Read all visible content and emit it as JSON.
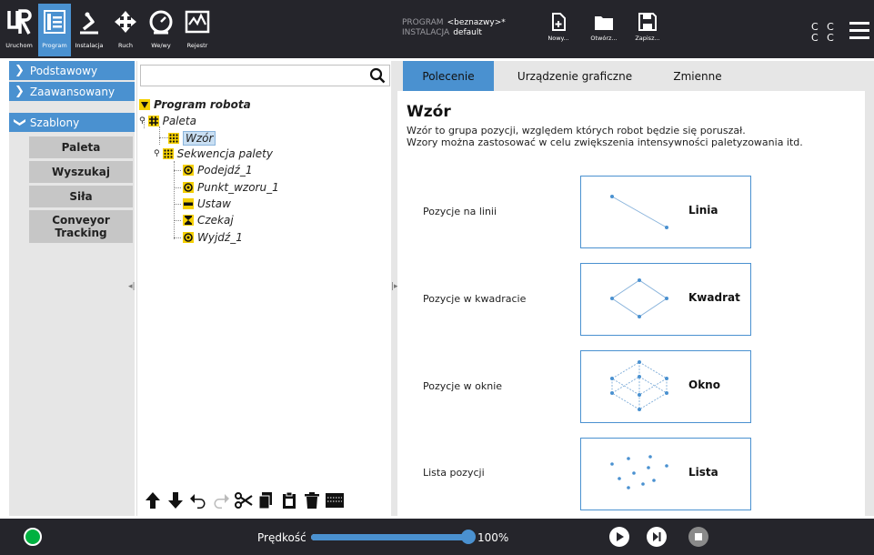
{
  "header": {
    "nav": [
      {
        "label": "Uruchom",
        "icon": "ur-logo-icon"
      },
      {
        "label": "Program",
        "icon": "program-tree-icon"
      },
      {
        "label": "Instalacja",
        "icon": "robot-arm-icon"
      },
      {
        "label": "Ruch",
        "icon": "move-arrows-icon"
      },
      {
        "label": "We/wy",
        "icon": "io-gauge-icon"
      },
      {
        "label": "Rejestr",
        "icon": "log-chart-icon"
      }
    ],
    "program_label": "PROGRAM",
    "program_value": "<beznazwy>*",
    "install_label": "INSTALACJA",
    "install_value": "default",
    "file_buttons": [
      {
        "label": "Nowy...",
        "icon": "new-file-icon"
      },
      {
        "label": "Otwórz...",
        "icon": "folder-icon"
      },
      {
        "label": "Zapisz...",
        "icon": "save-icon"
      }
    ],
    "cc_line1": "C C",
    "cc_line2": "C C"
  },
  "sidebar": {
    "categories": [
      {
        "label": "Podstawowy",
        "expanded": false
      },
      {
        "label": "Zaawansowany",
        "expanded": false
      },
      {
        "label": "Szablony",
        "expanded": true
      }
    ],
    "sub_items": [
      "Paleta",
      "Wyszukaj",
      "Siła",
      "Conveyor Tracking"
    ]
  },
  "search": {
    "placeholder": "",
    "value": ""
  },
  "tree": {
    "root": "Program robota",
    "nodes": [
      {
        "label": "Paleta",
        "icon": "pallet-grid-icon"
      },
      {
        "label": "Wzór",
        "icon": "pattern-dots-icon",
        "selected": true
      },
      {
        "label": "Sekwencja palety",
        "icon": "pattern-dots-icon"
      },
      {
        "label": "Podejdź_1",
        "icon": "waypoint-icon"
      },
      {
        "label": "Punkt_wzoru_1",
        "icon": "waypoint-icon"
      },
      {
        "label": "Ustaw",
        "icon": "set-bar-icon"
      },
      {
        "label": "Czekaj",
        "icon": "hourglass-icon"
      },
      {
        "label": "Wyjdź_1",
        "icon": "waypoint-icon"
      }
    ],
    "toolbar": [
      "move-up-icon",
      "move-down-icon",
      "undo-icon",
      "redo-icon",
      "cut-icon",
      "copy-icon",
      "paste-icon",
      "delete-icon",
      "suppress-icon"
    ]
  },
  "tabs": [
    {
      "label": "Polecenie",
      "active": true
    },
    {
      "label": "Urządzenie graficzne",
      "active": false
    },
    {
      "label": "Zmienne",
      "active": false
    }
  ],
  "command": {
    "title": "Wzór",
    "desc_line1": "Wzór to grupa pozycji, względem których robot będzie się poruszał.",
    "desc_line2": "Wzory można zastosować w celu zwiększenia intensywności paletyzowania itd.",
    "patterns": [
      {
        "row_label": "Pozycje na linii",
        "button_label": "Linia"
      },
      {
        "row_label": "Pozycje w kwadracie",
        "button_label": "Kwadrat"
      },
      {
        "row_label": "Pozycje w oknie",
        "button_label": "Okno"
      },
      {
        "row_label": "Lista pozycji",
        "button_label": "Lista"
      }
    ]
  },
  "footer": {
    "speed_label": "Prędkość",
    "speed_value": "100%",
    "speed_fraction": 1.0
  },
  "colors": {
    "accent": "#4a91d0",
    "header_bg": "#25252b",
    "power_green": "#00b140",
    "tree_yellow": "#f5d000"
  }
}
